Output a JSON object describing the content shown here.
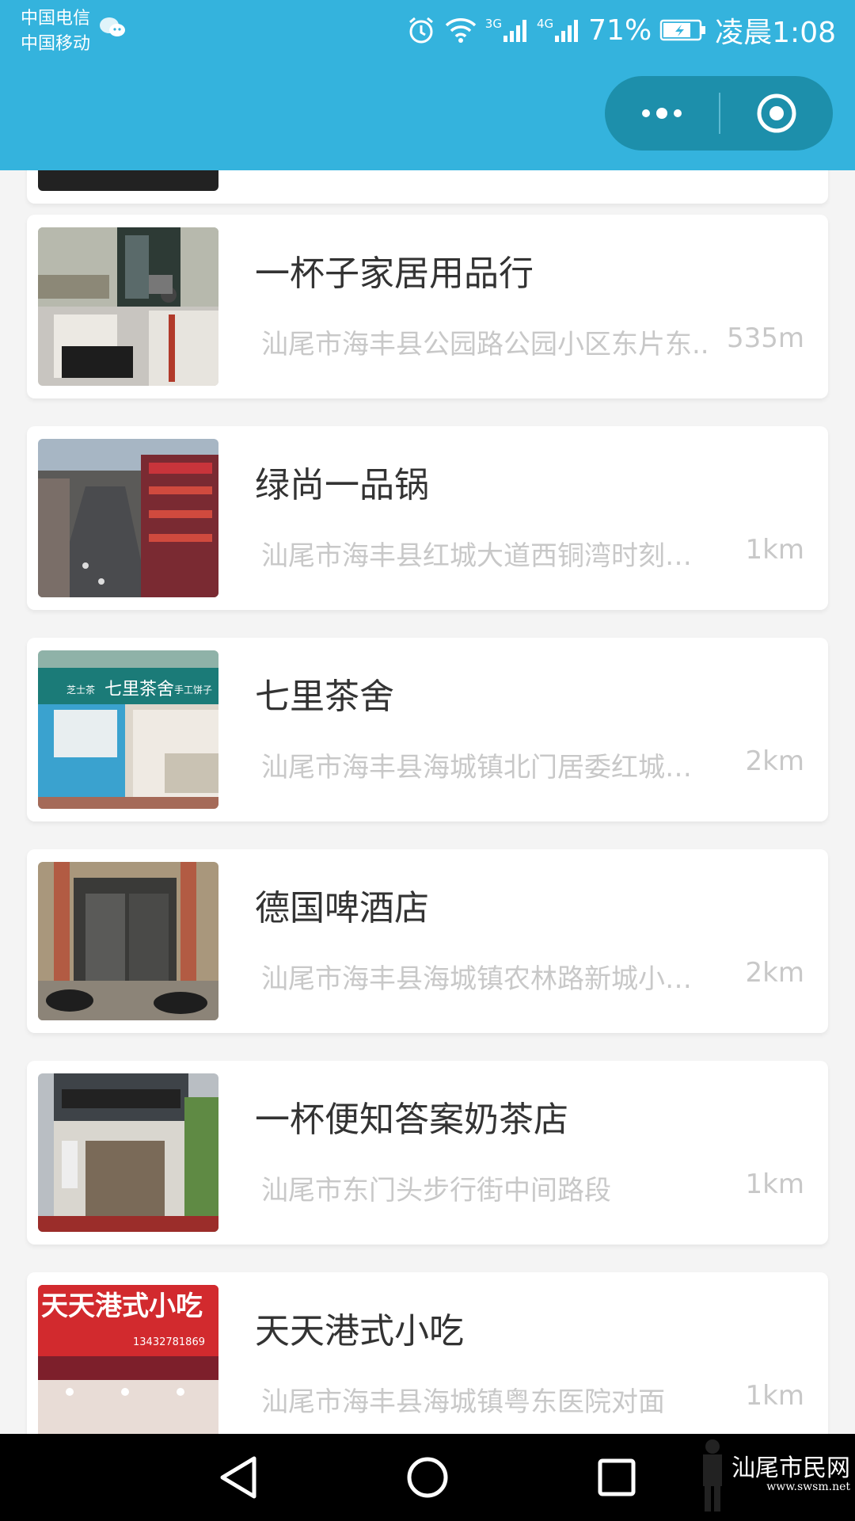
{
  "status_bar": {
    "carrier_1": "中国电信",
    "carrier_2": "中国移动",
    "signal_1": "3G",
    "signal_2": "4G",
    "battery": "71%",
    "time": "凌晨1:08"
  },
  "stores": [
    {
      "name": "一杯子家居用品行",
      "address": "汕尾市海丰县公园路公园小区东片东..",
      "distance": "535m"
    },
    {
      "name": "绿尚一品锅",
      "address": "汕尾市海丰县红城大道西铜湾时刻美...",
      "distance": "1km"
    },
    {
      "name": "七里茶舍",
      "address": "汕尾市海丰县海城镇北门居委红城南...",
      "distance": "2km"
    },
    {
      "name": "德国啤酒店",
      "address": "汕尾市海丰县海城镇农林路新城小学...",
      "distance": "2km"
    },
    {
      "name": "一杯便知答案奶茶店",
      "address": "汕尾市东门头步行街中间路段",
      "distance": "1km"
    },
    {
      "name": "天天港式小吃",
      "address": "汕尾市海丰县海城镇粤东医院对面",
      "distance": "1km"
    }
  ],
  "photo_signs": {
    "shop3_left": "芝士茶",
    "shop3_main": "七里茶舍",
    "shop3_right": "手工饼子",
    "shop6_title": "天天港式小吃",
    "shop6_phone": "13432781869"
  },
  "watermark": {
    "text": "汕尾市民网",
    "url": "www.swsm.net"
  },
  "colors": {
    "topbar": "#34b3dd",
    "capsule": "#1d8fab",
    "card_bg": "#ffffff",
    "title_text": "#333333",
    "muted_text": "#c8c8c8"
  }
}
